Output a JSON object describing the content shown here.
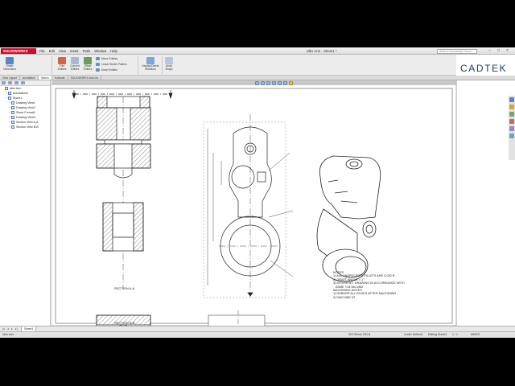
{
  "app": {
    "logo_text": "SOLIDWORKS",
    "document_title": "Idler Arm - Sheet1 *"
  },
  "menu": [
    "File",
    "Edit",
    "View",
    "Insert",
    "Tools",
    "Window",
    "Help"
  ],
  "search": {
    "placeholder": "Search Community Forum"
  },
  "ribbon": {
    "buttons": [
      {
        "label": "Smart Dimension",
        "icon": "smart-dimension-icon"
      },
      {
        "label": "Trim Entities",
        "icon": "trim-icon"
      },
      {
        "label": "Convert Entities",
        "icon": "convert-icon"
      },
      {
        "label": "Offset Entities",
        "icon": "offset-icon"
      },
      {
        "label": "Display/Delete Relations",
        "icon": "relations-icon"
      },
      {
        "label": "Quick Snaps",
        "icon": "quick-snaps-icon"
      }
    ],
    "small": [
      "Mirror Entities",
      "Linear Sketch Pattern",
      "Move Entities"
    ]
  },
  "tabs": [
    "View Layout",
    "Annotation",
    "Sketch",
    "Evaluate",
    "SOLIDWORKS Add-Ins"
  ],
  "active_tab": "Sketch",
  "brand": {
    "name": "CADTEK",
    "color": "#1c3d6e"
  },
  "tree": [
    {
      "label": "Idler Arm",
      "indent": 0,
      "icon": "drawing-icon"
    },
    {
      "label": "Annotations",
      "indent": 1,
      "icon": "annotations-icon"
    },
    {
      "label": "Sheet1",
      "indent": 1,
      "icon": "sheet-icon"
    },
    {
      "label": "Drawing View1",
      "indent": 2,
      "icon": "view-icon"
    },
    {
      "label": "Drawing View2",
      "indent": 2,
      "icon": "view-icon"
    },
    {
      "label": "Sheet Format1",
      "indent": 2,
      "icon": "sheet-format-icon"
    },
    {
      "label": "Drawing View3",
      "indent": 2,
      "icon": "view-icon"
    },
    {
      "label": "Section View A-A",
      "indent": 2,
      "icon": "section-view-icon"
    },
    {
      "label": "Section View B-B",
      "indent": 2,
      "icon": "section-view-icon"
    }
  ],
  "drawing": {
    "section_a_label": "SECTION A-A",
    "section_b_label": "SECTION B-B",
    "notes": [
      "NOTES",
      "1) ALL UNSPECIFIED FILLETS ARE 0.020 R",
      "2) DRAFT ANGLE = 1°",
      "3) INTERPRET DRAWING IN ACCORDANCE WITH",
      "   ASME Y14.5M-1982",
      "MACHINING NOTES",
      "1) DEBURR ALL EDGES AFTER MACHINING",
      "2) MACHINE AT"
    ]
  },
  "sheet_tab": "Sheet1",
  "status": {
    "doc": "Idler Arm",
    "coords": "303.99mm    201.8",
    "defined": "Under Defined",
    "editing": "Editing Sheet1",
    "scale": "1 : 1",
    "units": "MMGS"
  }
}
